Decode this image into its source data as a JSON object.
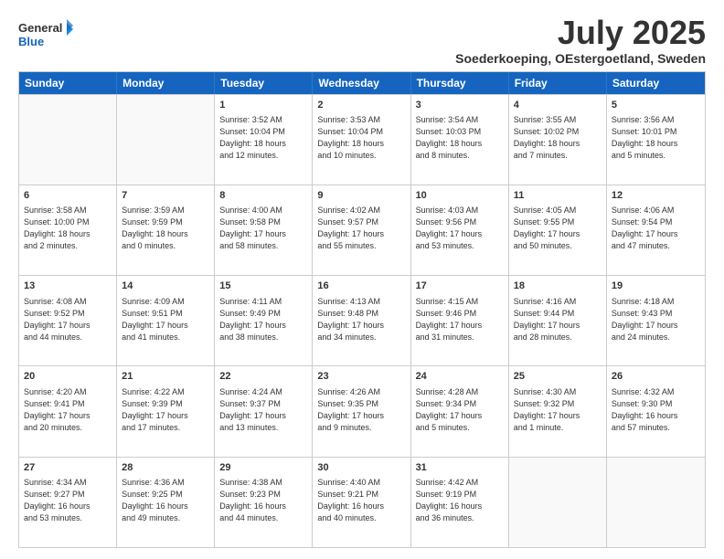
{
  "header": {
    "logo_general": "General",
    "logo_blue": "Blue",
    "main_title": "July 2025",
    "subtitle": "Soederkoeping, OEstergoetland, Sweden"
  },
  "weekdays": [
    "Sunday",
    "Monday",
    "Tuesday",
    "Wednesday",
    "Thursday",
    "Friday",
    "Saturday"
  ],
  "weeks": [
    [
      {
        "day": "",
        "info": ""
      },
      {
        "day": "",
        "info": ""
      },
      {
        "day": "1",
        "info": "Sunrise: 3:52 AM\nSunset: 10:04 PM\nDaylight: 18 hours\nand 12 minutes."
      },
      {
        "day": "2",
        "info": "Sunrise: 3:53 AM\nSunset: 10:04 PM\nDaylight: 18 hours\nand 10 minutes."
      },
      {
        "day": "3",
        "info": "Sunrise: 3:54 AM\nSunset: 10:03 PM\nDaylight: 18 hours\nand 8 minutes."
      },
      {
        "day": "4",
        "info": "Sunrise: 3:55 AM\nSunset: 10:02 PM\nDaylight: 18 hours\nand 7 minutes."
      },
      {
        "day": "5",
        "info": "Sunrise: 3:56 AM\nSunset: 10:01 PM\nDaylight: 18 hours\nand 5 minutes."
      }
    ],
    [
      {
        "day": "6",
        "info": "Sunrise: 3:58 AM\nSunset: 10:00 PM\nDaylight: 18 hours\nand 2 minutes."
      },
      {
        "day": "7",
        "info": "Sunrise: 3:59 AM\nSunset: 9:59 PM\nDaylight: 18 hours\nand 0 minutes."
      },
      {
        "day": "8",
        "info": "Sunrise: 4:00 AM\nSunset: 9:58 PM\nDaylight: 17 hours\nand 58 minutes."
      },
      {
        "day": "9",
        "info": "Sunrise: 4:02 AM\nSunset: 9:57 PM\nDaylight: 17 hours\nand 55 minutes."
      },
      {
        "day": "10",
        "info": "Sunrise: 4:03 AM\nSunset: 9:56 PM\nDaylight: 17 hours\nand 53 minutes."
      },
      {
        "day": "11",
        "info": "Sunrise: 4:05 AM\nSunset: 9:55 PM\nDaylight: 17 hours\nand 50 minutes."
      },
      {
        "day": "12",
        "info": "Sunrise: 4:06 AM\nSunset: 9:54 PM\nDaylight: 17 hours\nand 47 minutes."
      }
    ],
    [
      {
        "day": "13",
        "info": "Sunrise: 4:08 AM\nSunset: 9:52 PM\nDaylight: 17 hours\nand 44 minutes."
      },
      {
        "day": "14",
        "info": "Sunrise: 4:09 AM\nSunset: 9:51 PM\nDaylight: 17 hours\nand 41 minutes."
      },
      {
        "day": "15",
        "info": "Sunrise: 4:11 AM\nSunset: 9:49 PM\nDaylight: 17 hours\nand 38 minutes."
      },
      {
        "day": "16",
        "info": "Sunrise: 4:13 AM\nSunset: 9:48 PM\nDaylight: 17 hours\nand 34 minutes."
      },
      {
        "day": "17",
        "info": "Sunrise: 4:15 AM\nSunset: 9:46 PM\nDaylight: 17 hours\nand 31 minutes."
      },
      {
        "day": "18",
        "info": "Sunrise: 4:16 AM\nSunset: 9:44 PM\nDaylight: 17 hours\nand 28 minutes."
      },
      {
        "day": "19",
        "info": "Sunrise: 4:18 AM\nSunset: 9:43 PM\nDaylight: 17 hours\nand 24 minutes."
      }
    ],
    [
      {
        "day": "20",
        "info": "Sunrise: 4:20 AM\nSunset: 9:41 PM\nDaylight: 17 hours\nand 20 minutes."
      },
      {
        "day": "21",
        "info": "Sunrise: 4:22 AM\nSunset: 9:39 PM\nDaylight: 17 hours\nand 17 minutes."
      },
      {
        "day": "22",
        "info": "Sunrise: 4:24 AM\nSunset: 9:37 PM\nDaylight: 17 hours\nand 13 minutes."
      },
      {
        "day": "23",
        "info": "Sunrise: 4:26 AM\nSunset: 9:35 PM\nDaylight: 17 hours\nand 9 minutes."
      },
      {
        "day": "24",
        "info": "Sunrise: 4:28 AM\nSunset: 9:34 PM\nDaylight: 17 hours\nand 5 minutes."
      },
      {
        "day": "25",
        "info": "Sunrise: 4:30 AM\nSunset: 9:32 PM\nDaylight: 17 hours\nand 1 minute."
      },
      {
        "day": "26",
        "info": "Sunrise: 4:32 AM\nSunset: 9:30 PM\nDaylight: 16 hours\nand 57 minutes."
      }
    ],
    [
      {
        "day": "27",
        "info": "Sunrise: 4:34 AM\nSunset: 9:27 PM\nDaylight: 16 hours\nand 53 minutes."
      },
      {
        "day": "28",
        "info": "Sunrise: 4:36 AM\nSunset: 9:25 PM\nDaylight: 16 hours\nand 49 minutes."
      },
      {
        "day": "29",
        "info": "Sunrise: 4:38 AM\nSunset: 9:23 PM\nDaylight: 16 hours\nand 44 minutes."
      },
      {
        "day": "30",
        "info": "Sunrise: 4:40 AM\nSunset: 9:21 PM\nDaylight: 16 hours\nand 40 minutes."
      },
      {
        "day": "31",
        "info": "Sunrise: 4:42 AM\nSunset: 9:19 PM\nDaylight: 16 hours\nand 36 minutes."
      },
      {
        "day": "",
        "info": ""
      },
      {
        "day": "",
        "info": ""
      }
    ]
  ]
}
